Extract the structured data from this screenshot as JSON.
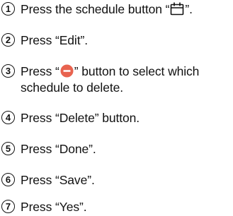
{
  "steps": [
    {
      "number": "1",
      "before": "Press the schedule button “",
      "icon": "calendar-icon",
      "after": "”."
    },
    {
      "number": "2",
      "text": "Press “Edit”."
    },
    {
      "number": "3",
      "before": "Press “",
      "icon": "minus-circle-icon",
      "after": "” button to select which",
      "line2": "schedule to delete."
    },
    {
      "number": "4",
      "text": "Press “Delete” button."
    },
    {
      "number": "5",
      "text": "Press “Done”."
    },
    {
      "number": "6",
      "text": "Press “Save”."
    },
    {
      "number": "7",
      "text": "Press “Yes”."
    }
  ],
  "colors": {
    "text": "#111111",
    "delete_icon": "#e8634f",
    "background": "#ffffff"
  }
}
